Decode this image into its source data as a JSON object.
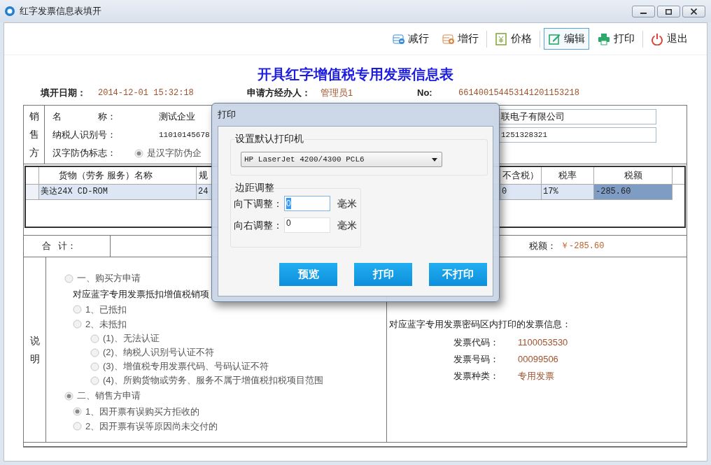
{
  "window": {
    "title": "红字发票信息表填开"
  },
  "toolbar": [
    {
      "kind": "remove_row",
      "label": "减行",
      "selected": false,
      "separator_after": false
    },
    {
      "kind": "add_row",
      "label": "增行",
      "selected": false,
      "separator_after": true
    },
    {
      "kind": "price",
      "label": "价格",
      "selected": false,
      "separator_after": true
    },
    {
      "kind": "edit",
      "label": "编辑",
      "selected": true,
      "separator_after": false
    },
    {
      "kind": "print",
      "label": "打印",
      "selected": false,
      "separator_after": true
    },
    {
      "kind": "exit",
      "label": "退出",
      "selected": false,
      "separator_after": false
    }
  ],
  "form_title": "开具红字增值税专用发票信息表",
  "header_info": [
    {
      "label": "填开日期：",
      "value": "2014-12-01 15:32:18"
    },
    {
      "label": "申请方经办人：",
      "value": "管理员1"
    },
    {
      "label": "No:",
      "value": "661400154453141201153218"
    }
  ],
  "seller": {
    "side_label": "销售方",
    "fields": [
      {
        "label": "名 称：",
        "value": "测试企业"
      },
      {
        "label": "纳税人识别号：",
        "value": "11010145678"
      }
    ],
    "anti_forgery": {
      "label": "汉字防伪标志：",
      "option": "是汉字防伪企",
      "checked": true
    }
  },
  "buyer": {
    "fields": [
      "联电子有限公司",
      "1251328321"
    ]
  },
  "goods_table": {
    "columns": [
      "货物（劳务 服务）名称",
      "规",
      "不含税）",
      "税率",
      "税额"
    ],
    "rows": [
      {
        "selected": true,
        "cells": [
          {
            "text": "美达24X CD-ROM",
            "focused": false
          },
          {
            "text": "24",
            "focused": false
          },
          {
            "text": "0",
            "focused": false
          },
          {
            "text": "17%",
            "focused": false
          },
          {
            "text": "-285.60",
            "focused": true
          }
        ]
      }
    ]
  },
  "total": {
    "label": "合 计：",
    "tax_label": "税额：",
    "tax_value": "￥-285.60"
  },
  "explanation": {
    "side_label": "说明",
    "options": [
      {
        "label": "一、购买方申请",
        "checked": false,
        "note": "对应蓝字专用发票抵扣增值税销项",
        "children": [
          {
            "label": "1、已抵扣",
            "checked": false
          },
          {
            "label": "2、未抵扣",
            "checked": false,
            "children": [
              {
                "label": "(1)、无法认证",
                "checked": false
              },
              {
                "label": "(2)、纳税人识别号认证不符",
                "checked": false
              },
              {
                "label": "(3)、增值税专用发票代码、号码认证不符",
                "checked": false
              },
              {
                "label": "(4)、所购货物或劳务、服务不属于增值税扣税项目范围",
                "checked": false
              }
            ]
          }
        ]
      },
      {
        "label": "二、销售方申请",
        "checked": true,
        "children": [
          {
            "label": "1、因开票有误购买方拒收的",
            "checked": true
          },
          {
            "label": "2、因开票有误等原因尚未交付的",
            "checked": false
          }
        ]
      }
    ],
    "right_title": "对应蓝字专用发票密码区内打印的发票信息：",
    "invoice_info": [
      {
        "label": "发票代码：",
        "value": "1100053530"
      },
      {
        "label": "发票号码：",
        "value": "00099506"
      },
      {
        "label": "发票种类：",
        "value": "专用发票"
      }
    ]
  },
  "dialog": {
    "title": "打印",
    "printer_group": "设置默认打印机",
    "printer": "HP LaserJet 4200/4300 PCL6",
    "margin_group": "边距调整",
    "margins": [
      {
        "label": "向下调整：",
        "value": "0",
        "unit": "毫米",
        "focused": true
      },
      {
        "label": "向右调整：",
        "value": "0",
        "unit": "毫米",
        "focused": false
      }
    ],
    "buttons": [
      "预览",
      "打印",
      "不打印"
    ]
  }
}
